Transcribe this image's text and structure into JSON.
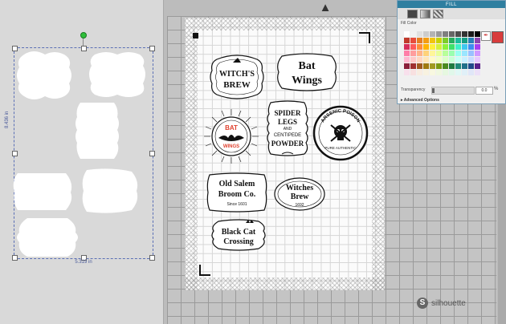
{
  "fill_panel": {
    "title": "FILL",
    "fill_color_label": "Fill Color",
    "transparency_label": "Transparency",
    "transparency_value": 0.0,
    "transparency_display": "0.0",
    "unit": "%",
    "advanced_label": "Advanced Options",
    "current_color": "#d83c3c",
    "palette": [
      "#ffffff",
      "#f2f2f2",
      "#e0e0e0",
      "#cccccc",
      "#b3b3b3",
      "#999999",
      "#7f7f7f",
      "#666666",
      "#4d4d4d",
      "#333333",
      "#1a1a1a",
      "#000000",
      "#c0392b",
      "#e74c3c",
      "#e67e22",
      "#f39c12",
      "#f1c40f",
      "#c7d300",
      "#7dcc2a",
      "#27ae60",
      "#1abc9c",
      "#16a085",
      "#2980b9",
      "#8e44ad",
      "#d62d5a",
      "#ff5b5b",
      "#ff8c3a",
      "#ffb400",
      "#fff03c",
      "#d6f03a",
      "#8df23a",
      "#3ee06a",
      "#3ef0c8",
      "#3ec8f0",
      "#3e8cf0",
      "#a83ef0",
      "#ff7ea8",
      "#ff9d9d",
      "#ffb48a",
      "#ffd27a",
      "#fff69a",
      "#e8ff9a",
      "#b8ff9a",
      "#9affb0",
      "#9afff0",
      "#9ae6ff",
      "#9ac0ff",
      "#d09aff",
      "#ffb8d0",
      "#ffc8c8",
      "#ffd6c0",
      "#ffe6b8",
      "#fffac8",
      "#f2ffc8",
      "#dcffc8",
      "#c8ffd6",
      "#c8fff8",
      "#c8f0ff",
      "#c8dcff",
      "#e8c8ff",
      "#8a1f3a",
      "#a03030",
      "#a05a20",
      "#a07a10",
      "#a09a20",
      "#7a9a10",
      "#4a8a20",
      "#207a40",
      "#208a7a",
      "#20708a",
      "#204a8a",
      "#5a208a",
      "#f8e0ec",
      "#f8e0e0",
      "#f8ece0",
      "#f8f2e0",
      "#f8f8e0",
      "#f0f8e0",
      "#e6f8e0",
      "#e0f8ea",
      "#e0f8f6",
      "#e0f0f8",
      "#e0e6f8",
      "#ece0f8"
    ]
  },
  "selection": {
    "width_label": "5.319 in",
    "height_label": "8.436 in"
  },
  "labels": {
    "witchs_brew_line1": "WITCH'S",
    "witchs_brew_line2": "BREW",
    "bat_wings_line1": "Bat",
    "bat_wings_line2": "Wings",
    "bat_wings_round_top": "BAT",
    "bat_wings_round_bottom": "WINGS",
    "spider_line1": "SPIDER",
    "spider_line2": "LEGS",
    "spider_line3": "AND",
    "spider_line4": "CENTIPEDE",
    "spider_line5": "POWDER",
    "arsenic_top": "ARSENIC POISON",
    "arsenic_bottom": "PURE AUTHENTIC",
    "salem_line1": "Old Salem",
    "salem_line2": "Broom Co.",
    "salem_line3": "Since 1601",
    "witches_brew_line1": "Witches",
    "witches_brew_line2": "Brew",
    "witches_brew_line3": "1692",
    "cat_line1": "Black Cat",
    "cat_line2": "Crossing"
  },
  "brand": {
    "name": "silhouette",
    "logo_letter": "S"
  },
  "icons": {
    "page_up": "arrow-up-icon",
    "eyedropper": "eyedropper-icon"
  }
}
